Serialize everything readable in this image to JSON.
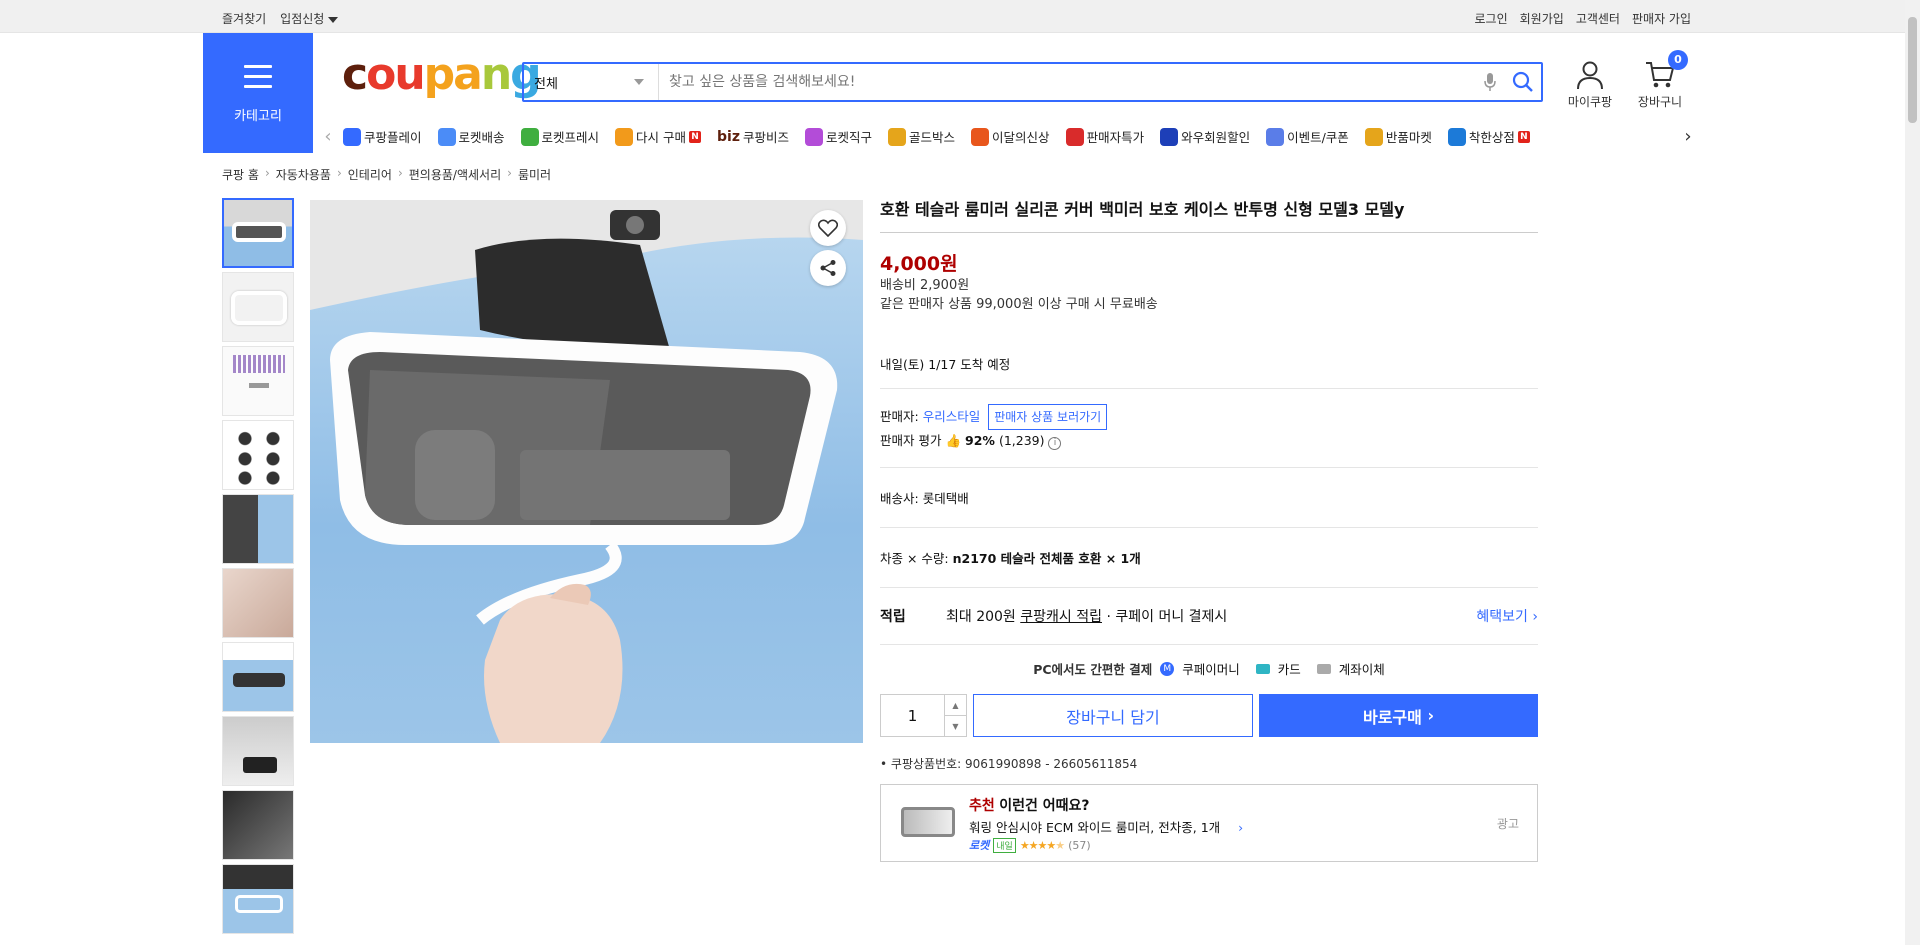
{
  "topbar": {
    "left": [
      "즐겨찾기",
      "입점신청"
    ],
    "right": [
      "로그인",
      "회원가입",
      "고객센터",
      "판매자 가입"
    ]
  },
  "header": {
    "category_label": "카테고리",
    "logo": [
      "c",
      "ou",
      "pa",
      "n",
      "g"
    ],
    "search_scope": "전체",
    "search_placeholder": "찾고 싶은 상품을 검색해보세요!",
    "mycoupang": "마이쿠팡",
    "cart": "장바구니",
    "cart_count": "0"
  },
  "gnb": {
    "items": [
      {
        "label": "쿠팡플레이",
        "icon": "play-icon",
        "color": "#346aff"
      },
      {
        "label": "로켓배송",
        "icon": "rocket-icon",
        "color": "#4b8cf7"
      },
      {
        "label": "로켓프레시",
        "icon": "rocket-fresh-icon",
        "color": "#3fae3f"
      },
      {
        "label": "다시 구매",
        "icon": "rebuy-icon",
        "color": "#f29a1b",
        "badge": "N"
      },
      {
        "label": "쿠팡비즈",
        "icon": "biz-icon",
        "color": "#5d1f0c",
        "prefix": "biz"
      },
      {
        "label": "로켓직구",
        "icon": "global-icon",
        "color": "#b34cd8"
      },
      {
        "label": "골드박스",
        "icon": "goldbox-icon",
        "color": "#e5a51b"
      },
      {
        "label": "이달의신상",
        "icon": "new-icon",
        "color": "#e8561c"
      },
      {
        "label": "판매자특가",
        "icon": "percent-icon",
        "color": "#d92b2b"
      },
      {
        "label": "와우회원할인",
        "icon": "wow-icon",
        "color": "#1d3fb8"
      },
      {
        "label": "이벤트/쿠폰",
        "icon": "coupon-icon",
        "color": "#5a7de8"
      },
      {
        "label": "반품마켓",
        "icon": "return-icon",
        "color": "#e5a51b"
      },
      {
        "label": "착한상점",
        "icon": "store-icon",
        "color": "#1c7ad8",
        "badge": "N"
      }
    ],
    "badge_label": "N"
  },
  "breadcrumb": [
    "쿠팡 홈",
    "자동차용품",
    "인테리어",
    "편의용품/액세서리",
    "룸미러"
  ],
  "product": {
    "title": "호환 테슬라 룸미러 실리콘 커버 백미러 보호 케이스 반투명 신형 모델3 모델y",
    "price": "4,000원",
    "shipping_fee": "배송비 2,900원",
    "free_ship": "같은 판매자 상품 99,000원 이상 구매 시 무료배송",
    "arrival": "내일(토) 1/17 도착 예정",
    "seller_label": "판매자:",
    "seller_name": "우리스타일",
    "seller_more": "판매자 상품 보러가기",
    "seller_rating_label": "판매자 평가",
    "seller_rating": "92%",
    "seller_rating_count": "(1,239)",
    "courier_label": "배송사:",
    "courier": "롯데택배",
    "option_label": "차종 × 수량:",
    "option_value": "n2170 테슬라 전체품 호환 × 1개",
    "points_label": "적립",
    "points_max": "최대 200원",
    "points_cash": "쿠팡캐시 적립",
    "points_cond": "· 쿠페이 머니 결제시",
    "benefit_link": "혜택보기",
    "pc_pay": "PC에서도 간편한 결제",
    "pay_methods": [
      "쿠페이머니",
      "카드",
      "계좌이체"
    ],
    "qty": "1",
    "add_to_cart": "장바구니 담기",
    "buy_now": "바로구매",
    "code_label": "쿠팡상품번호:",
    "code": "9061990898 - 26605611854"
  },
  "reco": {
    "tag": "추천",
    "heading": "이런건 어때요?",
    "name": "훠링 안심시야 ECM 와이드 룸미러, 전차종, 1개",
    "rocket": "로켓",
    "tomorrow": "내일",
    "rating": 4.5,
    "reviews": "(57)",
    "ad": "광고"
  }
}
